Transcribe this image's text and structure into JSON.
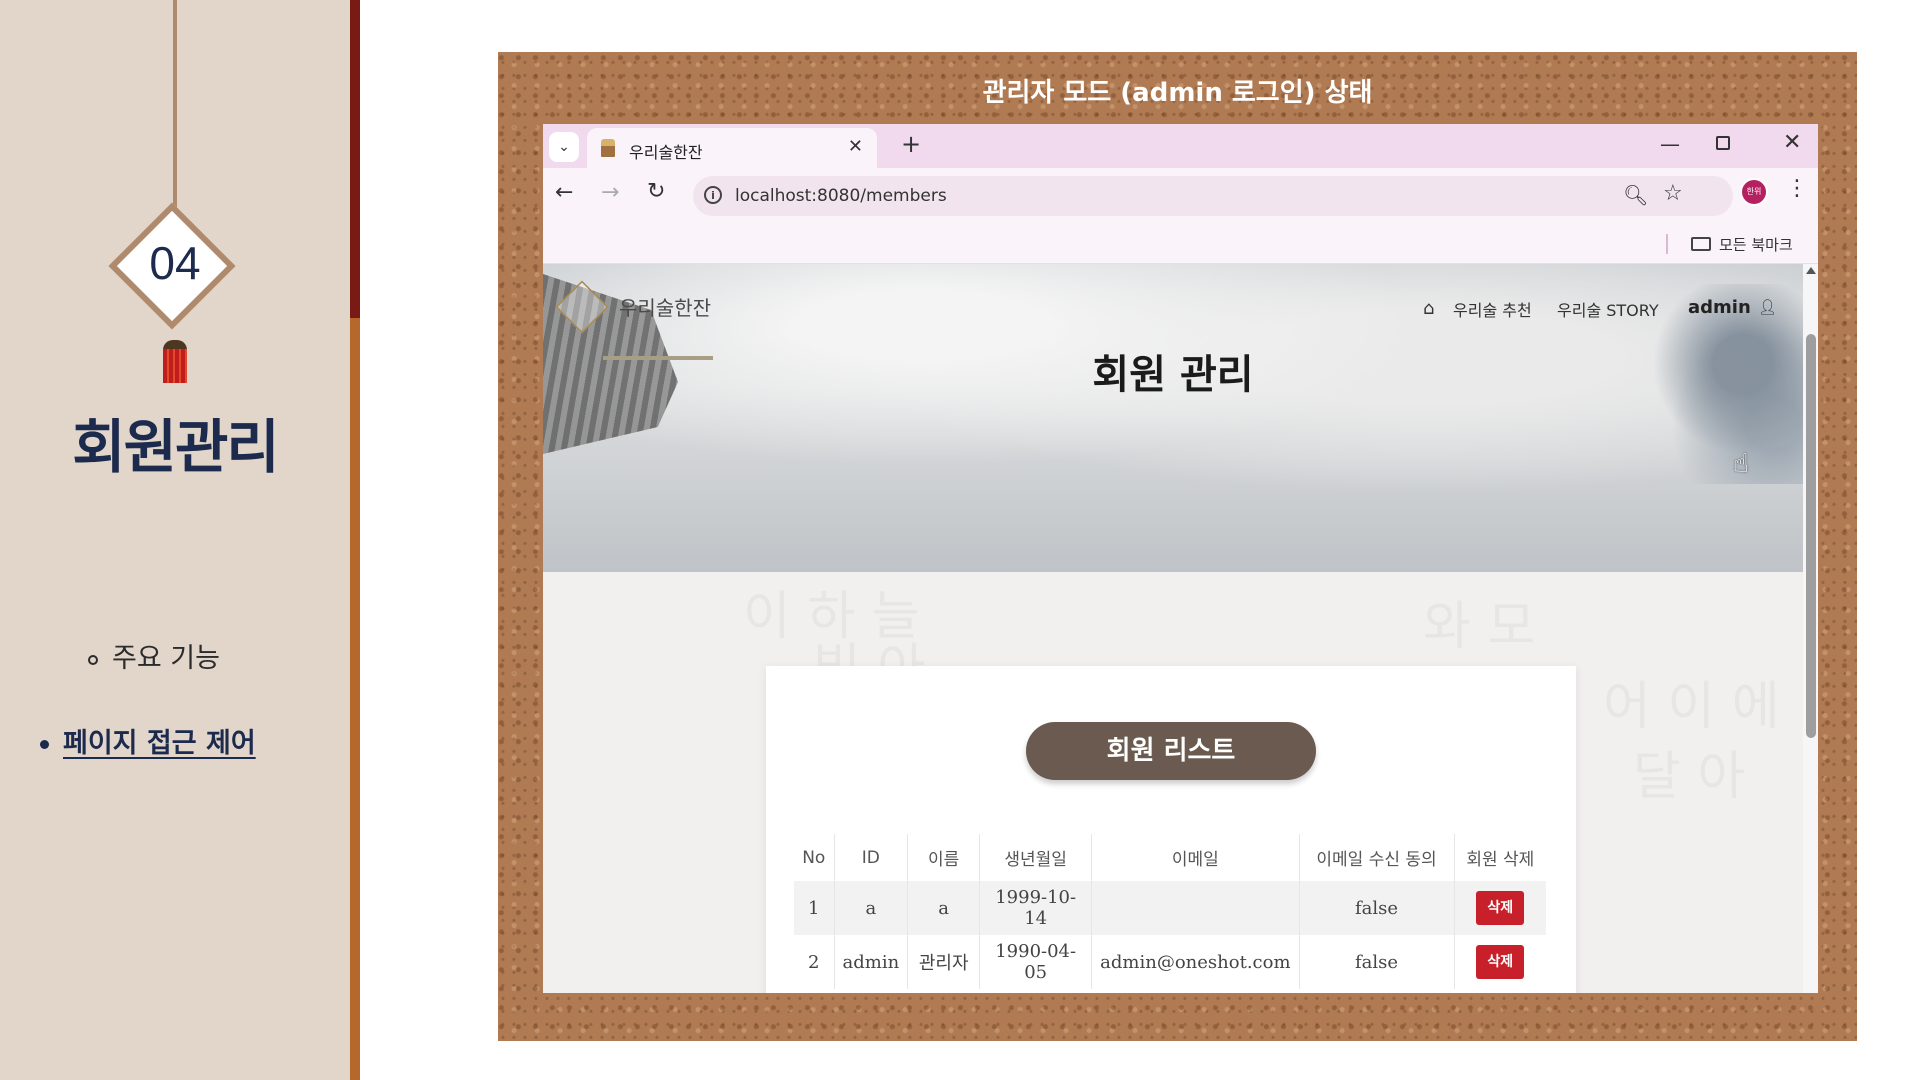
{
  "slide": {
    "section_number": "04",
    "section_title": "회원관리",
    "sub_items": [
      {
        "label": "주요 기능"
      },
      {
        "label": "페이지 접근 제어"
      }
    ],
    "caption": "관리자 모드 (admin 로그인) 상태"
  },
  "browser": {
    "tab": {
      "title": "우리술한잔",
      "close_symbol": "✕"
    },
    "new_tab_symbol": "+",
    "dropdown_symbol": "⌄",
    "window_controls": {
      "minimize": "—",
      "close": "✕"
    },
    "nav": {
      "back": "←",
      "forward": "→",
      "reload": "↻"
    },
    "address_bar": {
      "info_symbol": "i",
      "url": "localhost:8080/members"
    },
    "toolbar_icons": {
      "zoom": "🔍︎",
      "star": "☆",
      "menu": "⋮",
      "profile_text": "한위"
    },
    "bookmarks": {
      "all_bookmarks": "모든 북마크"
    }
  },
  "site": {
    "brand": "우리술한잔",
    "nav": {
      "home_symbol": "⌂",
      "links": [
        "우리술 추천",
        "우리술 STORY"
      ],
      "user": "admin",
      "user_symbol": "👤︎"
    },
    "page_title": "회원 관리",
    "background_calligraphy": [
      "이 하 늘",
      "빛 아",
      "와 모",
      "어 이 에",
      "달 아"
    ]
  },
  "members_card": {
    "heading": "회원 리스트",
    "columns": [
      "No",
      "ID",
      "이름",
      "생년월일",
      "이메일",
      "이메일 수신 동의",
      "회원 삭제"
    ],
    "rows": [
      {
        "no": "1",
        "id": "a",
        "name": "a",
        "birth": "1999-10-14",
        "email": "",
        "consent": "false",
        "action": "삭제"
      },
      {
        "no": "2",
        "id": "admin",
        "name": "관리자",
        "birth": "1990-04-05",
        "email": "admin@oneshot.com",
        "consent": "false",
        "action": "삭제"
      }
    ]
  },
  "colors": {
    "slide_panel": "#e2d6cb",
    "accent_dark": "#7a1a14",
    "accent_light": "#b4682c",
    "title_navy": "#1c2a4d",
    "pill": "#6a5a50",
    "delete_red": "#c8202a"
  }
}
